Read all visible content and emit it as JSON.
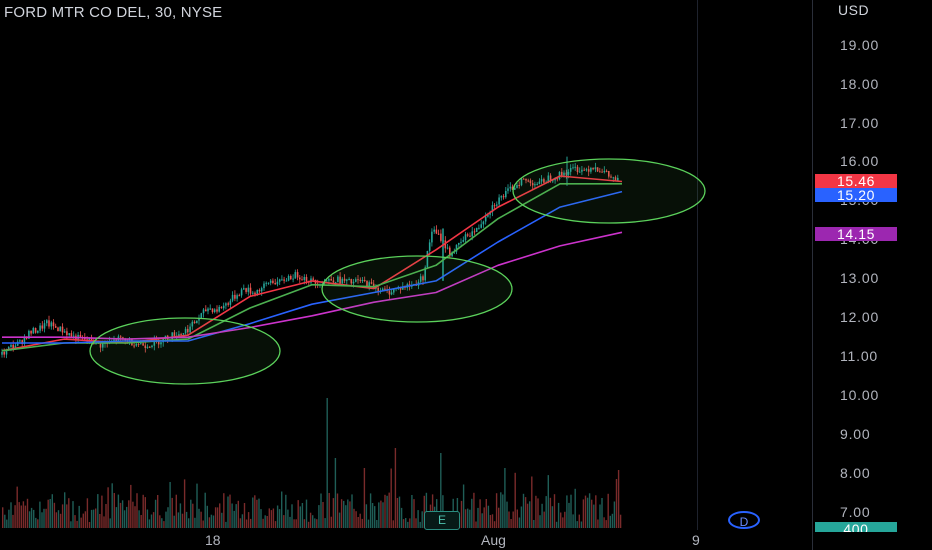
{
  "header": {
    "title": "FORD MTR CO DEL, 30, NYSE"
  },
  "axis": {
    "currency": "USD",
    "y_ticks": [
      "19.00",
      "18.00",
      "17.00",
      "16.00",
      "15.00",
      "14.00",
      "13.00",
      "12.00",
      "11.00",
      "10.00",
      "9.00",
      "8.00",
      "7.00"
    ],
    "x_ticks": [
      "18",
      "Aug",
      "9"
    ]
  },
  "price_tags": [
    {
      "label": "15.46",
      "value": 15.46,
      "color": "#f23645"
    },
    {
      "label": "15.20",
      "value": 15.2,
      "color": "#2962ff"
    },
    {
      "label": "14.15",
      "value": 14.15,
      "color": "#9c27b0"
    }
  ],
  "volume_tag": {
    "label": "400",
    "color": "#26a69a"
  },
  "events": {
    "earnings_label": "E",
    "dividend_label": "D"
  },
  "colors": {
    "background": "#000000",
    "up": "#26a69a",
    "down": "#ef5350",
    "ema_fast": "#f23645",
    "ema_mid": "#4caf50",
    "ema_slow": "#2962ff",
    "ema_long": "#cc33cc",
    "highlight_circle": "#5bd15b"
  },
  "chart_data": {
    "type": "candlestick",
    "symbol": "FORD MTR CO DEL",
    "interval": "30",
    "exchange": "NYSE",
    "ylim": [
      6.6,
      19.6
    ],
    "x_labels": [
      "18",
      "Aug",
      "9"
    ],
    "close_series": [
      11.0,
      11.2,
      11.3,
      11.55,
      11.65,
      11.8,
      11.7,
      11.6,
      11.45,
      11.4,
      11.35,
      11.25,
      11.3,
      11.4,
      11.35,
      11.3,
      11.25,
      11.3,
      11.4,
      11.5,
      11.55,
      11.7,
      11.95,
      12.2,
      12.15,
      12.3,
      12.5,
      12.7,
      12.6,
      12.7,
      12.9,
      12.85,
      13.0,
      13.05,
      12.95,
      12.85,
      12.9,
      12.95,
      12.9,
      12.85,
      12.9,
      12.8,
      12.7,
      12.6,
      12.7,
      12.75,
      12.8,
      13.0,
      14.2,
      14.0,
      13.6,
      13.8,
      14.1,
      14.2,
      14.6,
      14.9,
      15.1,
      15.3,
      15.5,
      15.45,
      15.4,
      15.55,
      15.6,
      15.7,
      15.8,
      15.75,
      15.85,
      15.75,
      15.55,
      15.46
    ],
    "series": [
      {
        "label_value": 15.46,
        "trend": [
          11.1,
          11.4,
          11.3,
          11.5,
          12.5,
          12.9,
          12.7,
          13.7,
          14.8,
          15.6,
          15.46
        ]
      },
      {
        "trend": [
          11.1,
          11.3,
          11.3,
          11.4,
          12.2,
          12.8,
          12.75,
          13.3,
          14.5,
          15.4,
          15.4
        ]
      },
      {
        "label_value": 15.2,
        "trend": [
          11.3,
          11.3,
          11.35,
          11.35,
          11.8,
          12.3,
          12.6,
          12.9,
          13.9,
          14.8,
          15.2
        ]
      },
      {
        "label_value": 14.15,
        "trend": [
          11.45,
          11.45,
          11.4,
          11.45,
          11.7,
          12.0,
          12.35,
          12.6,
          13.3,
          13.8,
          14.15
        ]
      }
    ],
    "volume_max_label": "400",
    "annotations": [
      "green ellipse highlights at three consolidation zones"
    ],
    "grid": true
  }
}
